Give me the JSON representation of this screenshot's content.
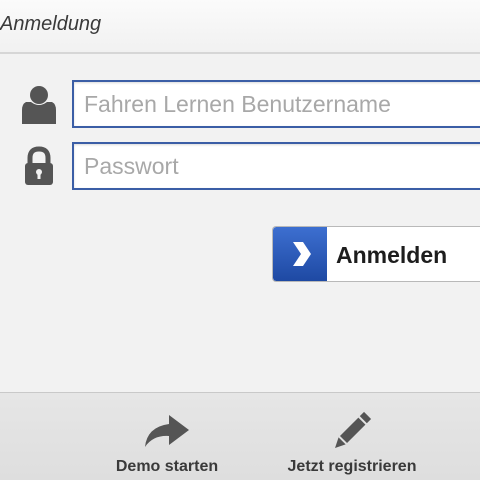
{
  "header": {
    "title": "Anmeldung"
  },
  "login_form": {
    "username": {
      "icon": "user-icon",
      "value": "",
      "placeholder": "Fahren Lernen Benutzername"
    },
    "password": {
      "icon": "lock-icon",
      "value": "",
      "placeholder": "Passwort"
    },
    "submit": {
      "icon": "chevron-right-icon",
      "label": "Anmelden"
    }
  },
  "footer": {
    "demo": {
      "icon": "share-arrow-icon",
      "label": "Demo starten"
    },
    "register": {
      "icon": "pencil-icon",
      "label": "Jetzt registrieren"
    }
  },
  "colors": {
    "input_border": "#3b5ea6",
    "button_accent": "#2a58b8",
    "icon_gray": "#555555",
    "background": "#f2f2f2"
  }
}
